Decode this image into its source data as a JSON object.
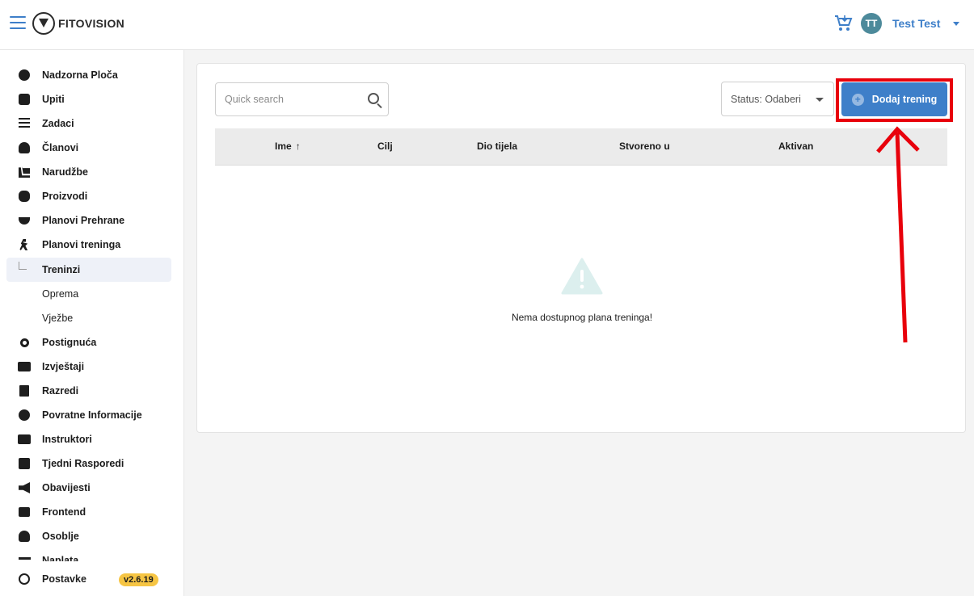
{
  "header": {
    "logo_text": "FITOVISION",
    "user_initials": "TT",
    "user_name": "Test Test"
  },
  "sidebar": {
    "items": [
      {
        "label": "Nadzorna Ploča",
        "icon": "dashboard-icon"
      },
      {
        "label": "Upiti",
        "icon": "chat-icon"
      },
      {
        "label": "Zadaci",
        "icon": "checklist-icon"
      },
      {
        "label": "Članovi",
        "icon": "members-icon"
      },
      {
        "label": "Narudžbe",
        "icon": "cart-icon"
      },
      {
        "label": "Proizvodi",
        "icon": "products-icon"
      },
      {
        "label": "Planovi Prehrane",
        "icon": "bowl-icon"
      },
      {
        "label": "Planovi treninga",
        "icon": "runner-icon"
      },
      {
        "label": "Treninzi",
        "icon": "branch-icon"
      },
      {
        "label": "Oprema",
        "icon": ""
      },
      {
        "label": "Vježbe",
        "icon": ""
      },
      {
        "label": "Postignuća",
        "icon": "award-icon"
      },
      {
        "label": "Izvještaji",
        "icon": "reports-icon"
      },
      {
        "label": "Razredi",
        "icon": "book-icon"
      },
      {
        "label": "Povratne Informacije",
        "icon": "smiley-icon"
      },
      {
        "label": "Instruktori",
        "icon": "instructor-icon"
      },
      {
        "label": "Tjedni Rasporedi",
        "icon": "calendar-icon"
      },
      {
        "label": "Obavijesti",
        "icon": "megaphone-icon"
      },
      {
        "label": "Frontend",
        "icon": "window-icon"
      },
      {
        "label": "Osoblje",
        "icon": "staff-icon"
      },
      {
        "label": "Naplata",
        "icon": "billing-icon"
      }
    ],
    "settings_label": "Postavke",
    "version": "v2.6.19"
  },
  "toolbar": {
    "search_placeholder": "Quick search",
    "status_label": "Status: Odaberi",
    "add_label": "Dodaj trening"
  },
  "table": {
    "columns": [
      "Ime",
      "Cilj",
      "Dio tijela",
      "Stvoreno u",
      "Aktivan"
    ],
    "sort_indicator": "↑",
    "empty_message": "Nema dostupnog plana treninga!"
  },
  "colors": {
    "accent": "#3e7fc9",
    "highlight": "#e8000b",
    "version_badge": "#f6c544"
  }
}
